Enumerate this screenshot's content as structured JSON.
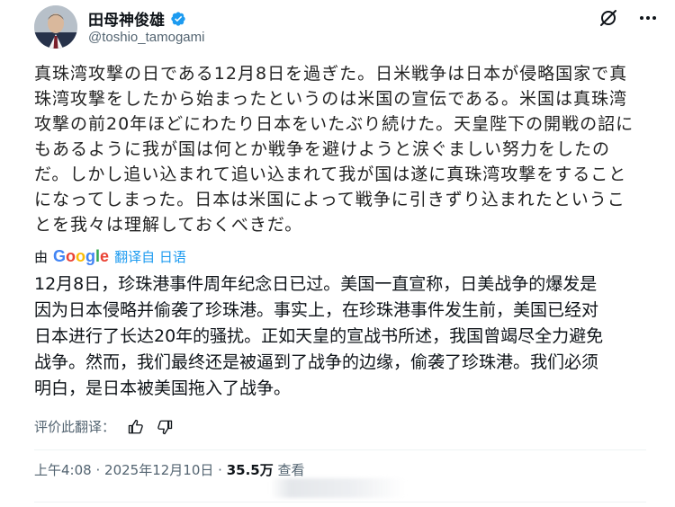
{
  "author": {
    "display_name": "田母神俊雄",
    "handle": "@toshio_tamogami"
  },
  "icons": {
    "verified": "verified-badge-icon",
    "grok": "grok-icon",
    "more": "more-icon",
    "thumb_up": "thumb-up-icon",
    "thumb_down": "thumb-down-icon"
  },
  "colors": {
    "accent": "#1d9bf0",
    "secondary_text": "#536471",
    "primary_text": "#0f1419"
  },
  "tweet": {
    "lines": [
      "真珠湾攻撃の日である12月8日を過ぎた。日米戦争は日本が侵略国家で真",
      "珠湾攻撃をしたから始まったというのは米国の宣伝である。米国は真珠湾",
      "攻撃の前20年ほどにわたり日本をいたぶり続けた。天皇陛下の開戦の詔に",
      "もあるように我が国は何とか戦争を避けようと涙ぐましい努力をしたの",
      "だ。しかし追い込まれて追い込まれて我が国は遂に真珠湾攻撃をすること",
      "になってしまった。日本は米国によって戦争に引きずり込まれたというこ",
      "とを我々は理解しておくべきだ。"
    ]
  },
  "translation": {
    "by_label": "由",
    "provider": "Google",
    "link_label": "翻译自 日语",
    "lines": [
      "12月8日，珍珠港事件周年纪念日已过。美国一直宣称，日美战争的爆发是",
      "因为日本侵略并偷袭了珍珠港。事实上，在珍珠港事件发生前，美国已经对",
      "日本进行了长达20年的骚扰。正如天皇的宣战书所述，我国曾竭尽全力避免",
      "战争。然而，我们最终还是被逼到了战争的边缘，偷袭了珍珠港。我们必须",
      "明白，是日本被美国拖入了战争。"
    ],
    "rate_label": "评价此翻译："
  },
  "meta": {
    "time": "上午4:08",
    "date": "2025年12月10日",
    "separator": "·",
    "views_count": "35.5万",
    "views_label": "查看"
  }
}
